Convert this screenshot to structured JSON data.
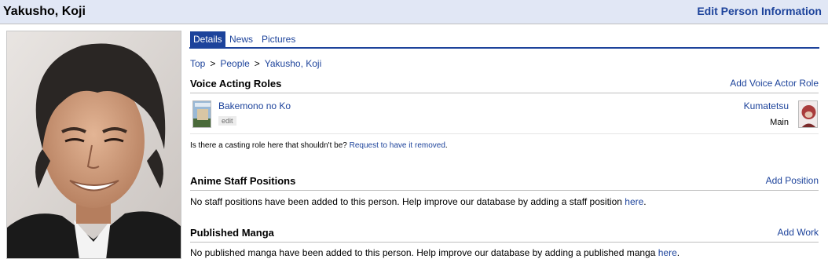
{
  "header": {
    "title": "Yakusho, Koji",
    "edit_label": "Edit Person Information"
  },
  "tabs": [
    {
      "label": "Details",
      "active": true
    },
    {
      "label": "News",
      "active": false
    },
    {
      "label": "Pictures",
      "active": false
    }
  ],
  "breadcrumb": {
    "items": [
      "Top",
      "People",
      "Yakusho, Koji"
    ],
    "separator": ">"
  },
  "voice_acting": {
    "title": "Voice Acting Roles",
    "action": "Add Voice Actor Role",
    "roles": [
      {
        "anime": "Bakemono no Ko",
        "edit_label": "edit",
        "character": "Kumatetsu",
        "role": "Main"
      }
    ],
    "casting_note": "Is there a casting role here that shouldn't be?",
    "casting_link": "Request to have it removed",
    "casting_end": "."
  },
  "staff": {
    "title": "Anime Staff Positions",
    "action": "Add Position",
    "message": "No staff positions have been added to this person. Help improve our database by adding a staff position",
    "link": "here",
    "end": "."
  },
  "manga": {
    "title": "Published Manga",
    "action": "Add Work",
    "message": "No published manga have been added to this person. Help improve our database by adding a published manga",
    "link": "here",
    "end": "."
  },
  "colors": {
    "link": "#1d439b",
    "header_bg": "#e1e7f5",
    "tab_active": "#1d439b"
  }
}
